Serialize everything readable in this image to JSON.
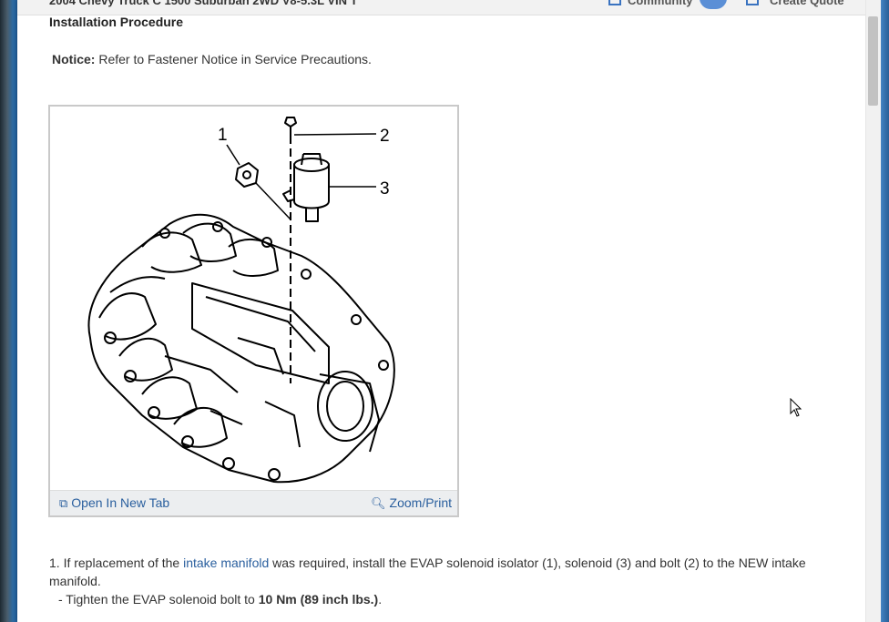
{
  "header": {
    "doc_title": "2004 Chevy Truck C 1500 Suburban 2WD V8-5.3L VIN T",
    "community_label": "Community",
    "create_quote_label": "Create Quote"
  },
  "section": {
    "heading": "Installation Procedure",
    "notice_label": "Notice:",
    "notice_text": " Refer to Fastener Notice in Service Precautions."
  },
  "figure": {
    "callouts": [
      "1",
      "2",
      "3"
    ],
    "open_tab_label": "Open In New Tab",
    "zoom_label": "Zoom/Print"
  },
  "steps": {
    "step1_prefix": "1. If replacement of the ",
    "step1_link": "intake manifold",
    "step1_suffix": " was required, install the EVAP solenoid isolator (1), solenoid (3) and bolt (2) to the NEW intake manifold.",
    "sub_prefix": "-  Tighten the EVAP solenoid bolt to ",
    "sub_bold": "10 Nm (89 inch lbs.)",
    "sub_suffix": "."
  },
  "colors": {
    "link": "#2a5f9e",
    "accent": "#3a73c0"
  }
}
